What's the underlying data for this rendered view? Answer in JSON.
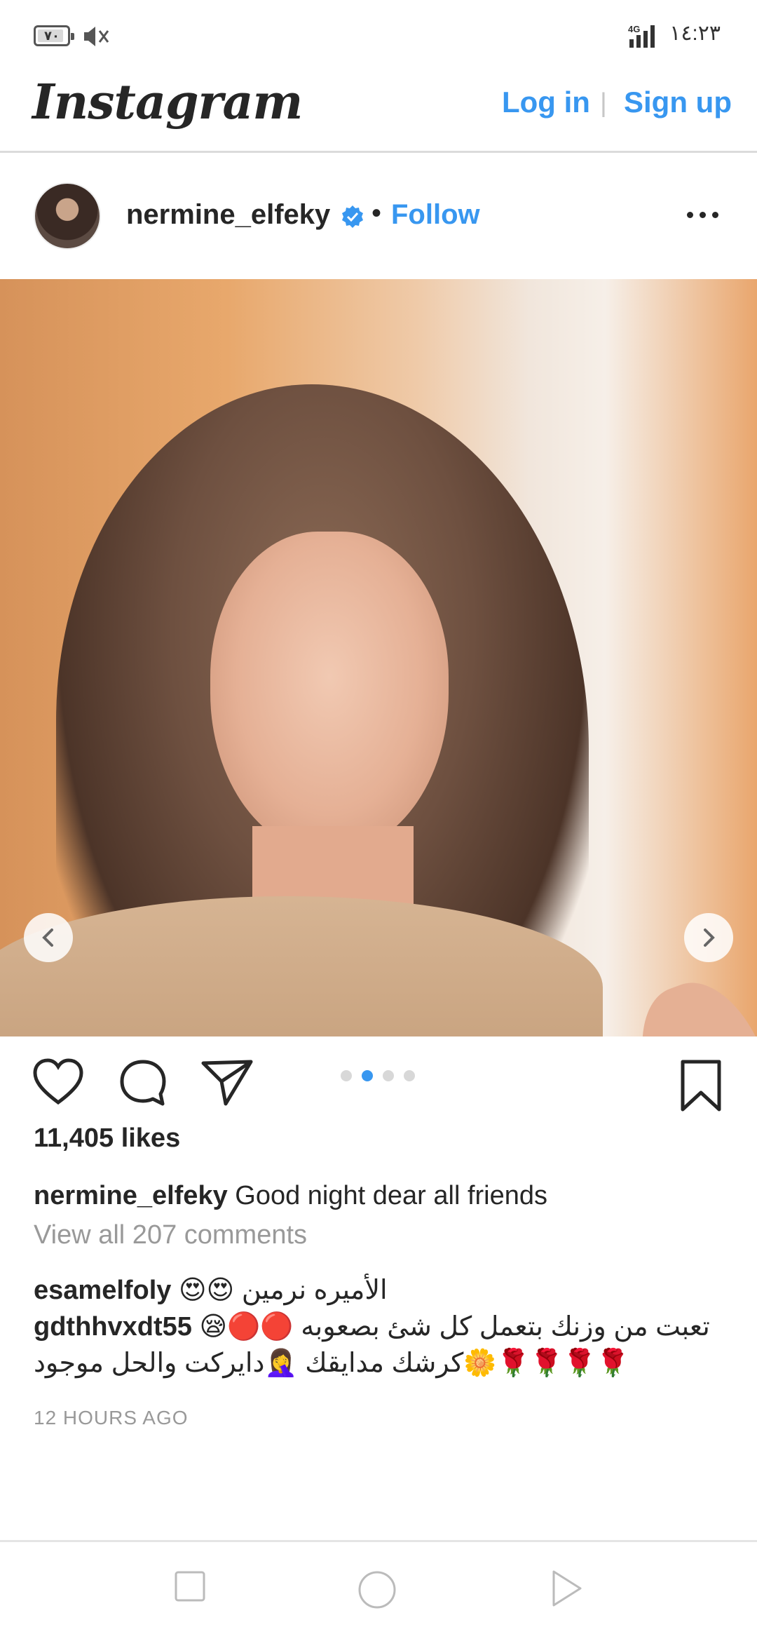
{
  "status_bar": {
    "battery": "٧٠",
    "network": "4G",
    "time": "١٤:٢٣"
  },
  "header": {
    "logo": "Instagram",
    "login_label": "Log in",
    "separator": "|",
    "signup_label": "Sign up"
  },
  "post": {
    "username": "nermine_elfeky",
    "dot": "•",
    "follow_label": "Follow",
    "carousel_total": 4,
    "carousel_active": 2,
    "likes": "11,405 likes",
    "caption_user": "nermine_elfeky",
    "caption_text": "Good night dear all friends",
    "view_comments": "View all 207 comments",
    "comments": [
      {
        "user": "esamelfoly",
        "text": "😍😍 الأميره نرمين"
      },
      {
        "user": "gdthhvxdt55",
        "text": "😪🔴🔴 تعبت من وزنك بتعمل كل شئ بصعوبه 🌹🌹🌹🌹🌼كرشك مدايقك 🤦‍♀️دايركت والحل موجود"
      }
    ],
    "time_ago": "12 HOURS AGO"
  },
  "colors": {
    "accent": "#3897f0",
    "text": "#262626",
    "muted": "#999999"
  },
  "icons": [
    "battery-icon",
    "mute-icon",
    "signal-icon",
    "verified-icon",
    "more-icon",
    "chevron-left-icon",
    "chevron-right-icon",
    "heart-icon",
    "comment-icon",
    "share-icon",
    "bookmark-icon",
    "square-icon",
    "circle-icon",
    "triangle-icon"
  ]
}
